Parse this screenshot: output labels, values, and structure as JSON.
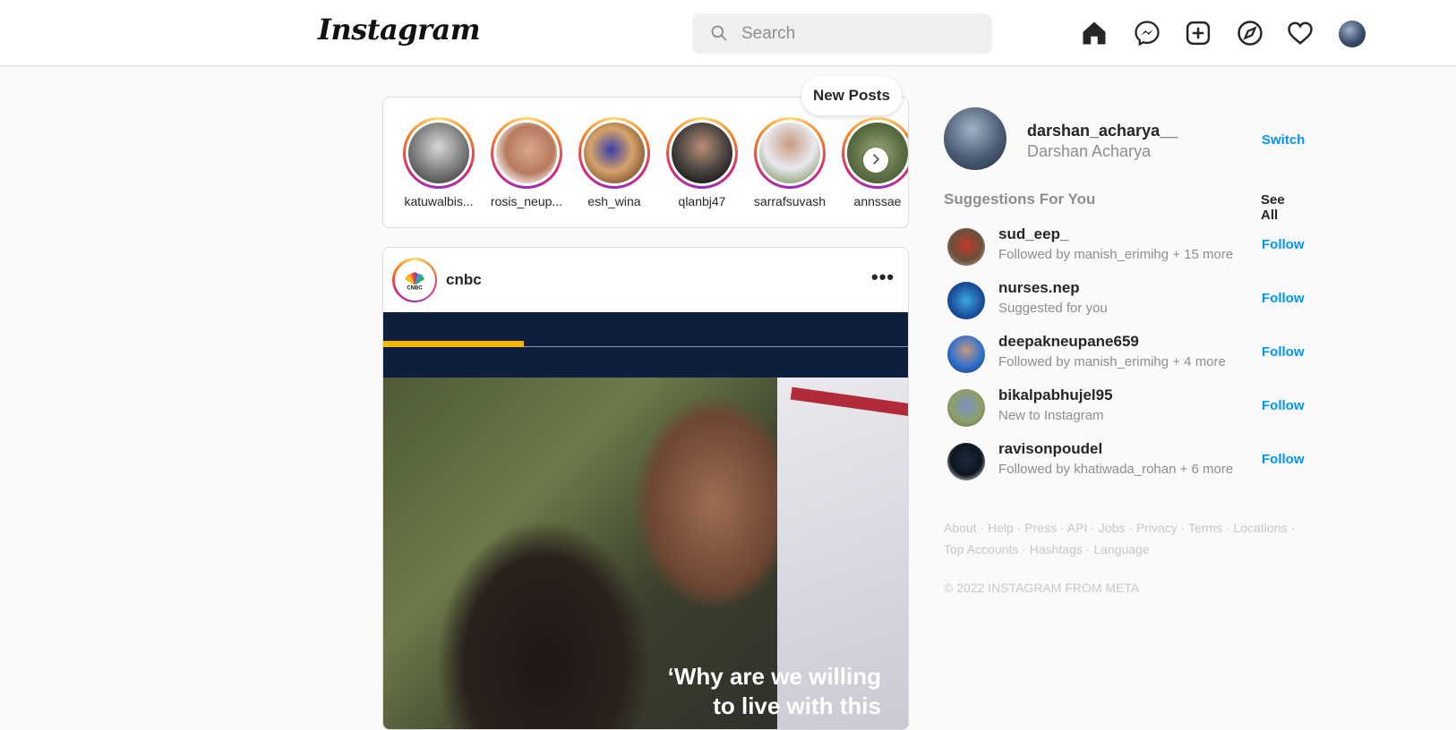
{
  "header": {
    "logo": "Instagram",
    "search_placeholder": "Search",
    "nav_icons": [
      "home-icon",
      "messenger-icon",
      "new-post-icon",
      "explore-icon",
      "activity-heart-icon",
      "profile-avatar"
    ]
  },
  "stories": [
    {
      "username": "katuwalbis..."
    },
    {
      "username": "rosis_neup..."
    },
    {
      "username": "esh_wina"
    },
    {
      "username": "qlanbj47"
    },
    {
      "username": "sarrafsuvash"
    },
    {
      "username": "annssae"
    }
  ],
  "new_posts_label": "New Posts",
  "post": {
    "username": "cnbc",
    "more": "•••",
    "quote_line1": "‘Why are we willing",
    "quote_line2": "to live with this"
  },
  "profile": {
    "username": "darshan_acharya__",
    "name": "Darshan Acharya",
    "switch_label": "Switch"
  },
  "suggestions": {
    "title": "Suggestions For You",
    "see_all": "See All",
    "items": [
      {
        "username": "sud_eep_",
        "detail": "Followed by manish_erimihg + 15 more",
        "action": "Follow"
      },
      {
        "username": "nurses.nep",
        "detail": "Suggested for you",
        "action": "Follow"
      },
      {
        "username": "deepakneupane659",
        "detail": "Followed by manish_erimihg + 4 more",
        "action": "Follow"
      },
      {
        "username": "bikalpabhujel95",
        "detail": "New to Instagram",
        "action": "Follow"
      },
      {
        "username": "ravisonpoudel",
        "detail": "Followed by khatiwada_rohan + 6 more",
        "action": "Follow"
      }
    ]
  },
  "footer": {
    "links": [
      "About",
      "Help",
      "Press",
      "API",
      "Jobs",
      "Privacy",
      "Terms",
      "Locations",
      "Top Accounts",
      "Hashtags",
      "Language"
    ],
    "copyright": "© 2022 INSTAGRAM FROM META"
  },
  "colors": {
    "accent": "#0095f6",
    "border": "#dbdbdb",
    "muted": "#8e8e8e"
  }
}
